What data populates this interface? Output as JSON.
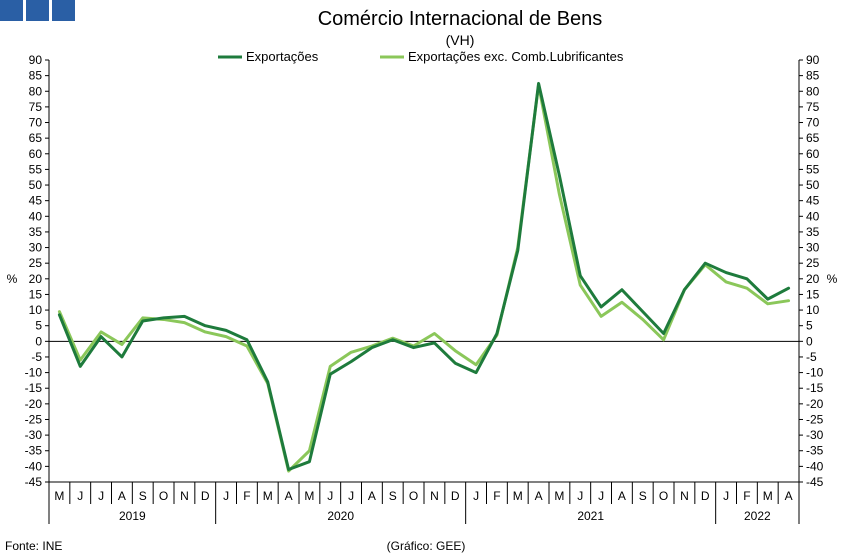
{
  "logo": {
    "name": "gee-logo",
    "color": "#2a5fa5"
  },
  "chart_data": {
    "type": "line",
    "title": "Comércio Internacional de Bens",
    "subtitle": "(VH)",
    "ylabel_left": "%",
    "ylabel_right": "%",
    "ylim": [
      -45,
      90
    ],
    "y_ticks": [
      90,
      85,
      80,
      75,
      70,
      65,
      60,
      55,
      50,
      45,
      40,
      35,
      30,
      25,
      20,
      15,
      10,
      5,
      0,
      -5,
      -10,
      -15,
      -20,
      -25,
      -30,
      -35,
      -40,
      -45
    ],
    "grid": false,
    "legend_position": "top-center",
    "categories": [
      "M",
      "J",
      "J",
      "A",
      "S",
      "O",
      "N",
      "D",
      "J",
      "F",
      "M",
      "A",
      "M",
      "J",
      "J",
      "A",
      "S",
      "O",
      "N",
      "D",
      "J",
      "F",
      "M",
      "A",
      "M",
      "J",
      "J",
      "A",
      "S",
      "O",
      "N",
      "D",
      "J",
      "F",
      "M",
      "A"
    ],
    "years": [
      {
        "label": "2019",
        "start": 0,
        "end": 8
      },
      {
        "label": "2020",
        "start": 8,
        "end": 20
      },
      {
        "label": "2021",
        "start": 20,
        "end": 32
      },
      {
        "label": "2022",
        "start": 32,
        "end": 36
      }
    ],
    "series": [
      {
        "name": "Exportações",
        "color": "#1e7b3c",
        "values": [
          8.5,
          -8,
          1.5,
          -5,
          6.5,
          7.5,
          8,
          5,
          3.5,
          0.5,
          -13,
          -41,
          -38.5,
          -10.5,
          -6.5,
          -2,
          0.5,
          -2,
          -0.5,
          -7,
          -10,
          2.5,
          29,
          82.5,
          53,
          21,
          11,
          16.5,
          9.5,
          2.5,
          16.5,
          25,
          22,
          20,
          13.5,
          17
        ]
      },
      {
        "name": "Exportações exc. Comb.Lubrificantes",
        "color": "#8bc75a",
        "values": [
          9.5,
          -6,
          3,
          -1,
          7.5,
          7,
          6,
          3,
          1.5,
          -1.5,
          -13.5,
          -41.5,
          -35,
          -8,
          -3.5,
          -1.5,
          1,
          -1.5,
          2.5,
          -3,
          -7.5,
          2,
          30,
          82,
          47,
          18,
          8,
          12.5,
          7,
          0.5,
          16.5,
          24.5,
          19,
          17,
          12,
          13
        ]
      }
    ],
    "source": "Fonte: INE",
    "credit": "(Gráfico: GEE)"
  }
}
